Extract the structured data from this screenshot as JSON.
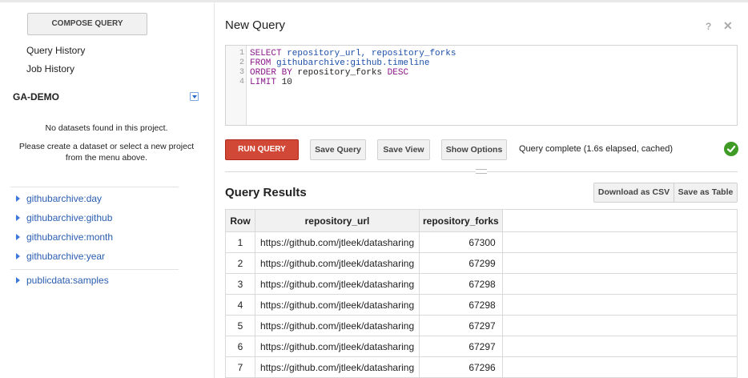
{
  "sidebar": {
    "compose_label": "COMPOSE QUERY",
    "nav": [
      {
        "label": "Query History"
      },
      {
        "label": "Job History"
      }
    ],
    "project": {
      "name": "GA-DEMO",
      "empty_line1": "No datasets found in this project.",
      "empty_line2": "Please create a dataset or select a new project from the menu above."
    },
    "datasets": [
      {
        "label": "githubarchive:day"
      },
      {
        "label": "githubarchive:github"
      },
      {
        "label": "githubarchive:month"
      },
      {
        "label": "githubarchive:year"
      }
    ],
    "public": [
      {
        "label": "publicdata:samples"
      }
    ]
  },
  "editor": {
    "title": "New Query",
    "help_glyph": "?",
    "close_glyph": "✕",
    "lines": [
      {
        "n": "1",
        "kw": "SELECT",
        "rest": " repository_url, repository_forks"
      },
      {
        "n": "2",
        "kw": "FROM",
        "rest": " githubarchive:github.timeline"
      },
      {
        "n": "3",
        "kw": "ORDER BY",
        "rest": " repository_forks ",
        "kw2": "DESC"
      },
      {
        "n": "4",
        "kw": "LIMIT",
        "rest": " 10"
      }
    ]
  },
  "toolbar": {
    "run_label": "RUN QUERY",
    "save_query_label": "Save Query",
    "save_view_label": "Save View",
    "show_options_label": "Show Options",
    "status": "Query complete (1.6s elapsed, cached)",
    "status_color": "#3f9b25"
  },
  "results": {
    "title": "Query Results",
    "download_csv_label": "Download as CSV",
    "save_table_label": "Save as Table",
    "columns": [
      "Row",
      "repository_url",
      "repository_forks"
    ],
    "rows": [
      {
        "row": "1",
        "url": "https://github.com/jtleek/datasharing",
        "forks": "67300"
      },
      {
        "row": "2",
        "url": "https://github.com/jtleek/datasharing",
        "forks": "67299"
      },
      {
        "row": "3",
        "url": "https://github.com/jtleek/datasharing",
        "forks": "67298"
      },
      {
        "row": "4",
        "url": "https://github.com/jtleek/datasharing",
        "forks": "67298"
      },
      {
        "row": "5",
        "url": "https://github.com/jtleek/datasharing",
        "forks": "67297"
      },
      {
        "row": "6",
        "url": "https://github.com/jtleek/datasharing",
        "forks": "67297"
      },
      {
        "row": "7",
        "url": "https://github.com/jtleek/datasharing",
        "forks": "67296"
      }
    ]
  },
  "colors": {
    "run_button": "#d14836",
    "link_blue": "#2a5db0"
  }
}
